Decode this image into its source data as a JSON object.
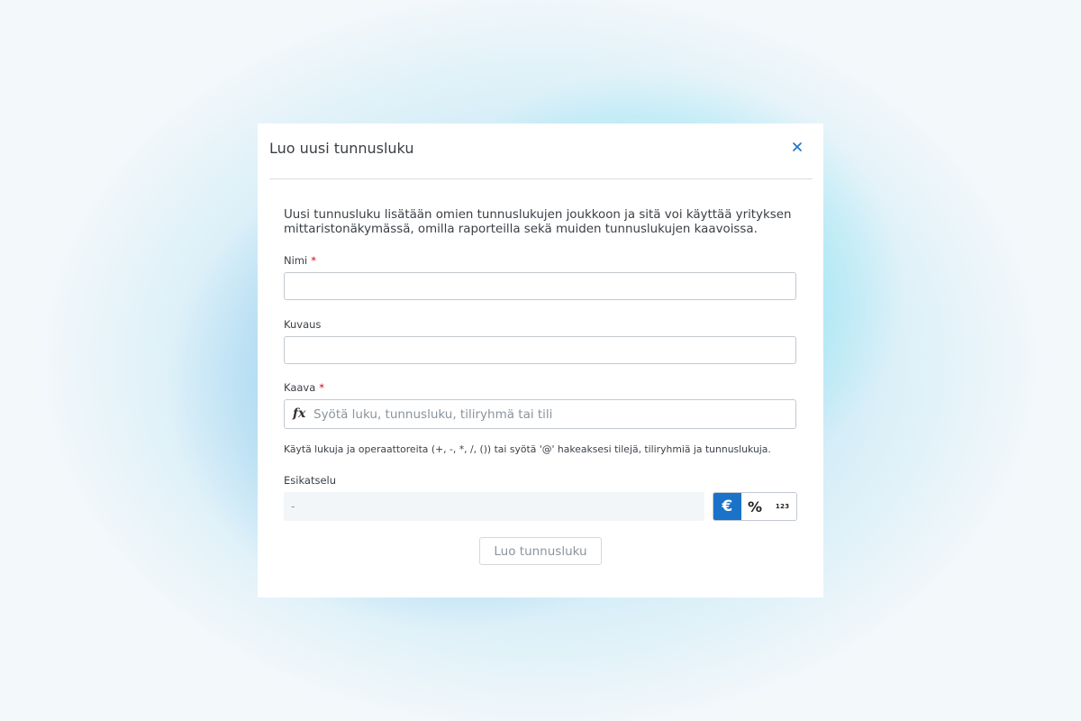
{
  "dialog": {
    "title": "Luo uusi tunnusluku",
    "close_icon": "close-icon",
    "intro_text": "Uusi tunnusluku lisätään omien tunnuslukujen joukkoon ja sitä voi käyttää yrityksen mittaristonäkymässä, omilla raporteilla sekä muiden tunnuslukujen kaavoissa.",
    "name_field": {
      "label": "Nimi",
      "required_mark": "*",
      "value": ""
    },
    "description_field": {
      "label": "Kuvaus",
      "value": ""
    },
    "formula_field": {
      "label": "Kaava",
      "required_mark": "*",
      "icon": "fx",
      "placeholder": "Syötä luku, tunnusluku, tiliryhmä tai tili",
      "hint": "Käytä lukuja ja operaattoreita (+, -, *, /, ()) tai syötä '@' hakeaksesi tilejä, tiliryhmiä ja tunnuslukuja."
    },
    "preview": {
      "label": "Esikatselu",
      "value": "-",
      "units": [
        {
          "symbol": "€",
          "active": true
        },
        {
          "symbol": "%",
          "active": false
        },
        {
          "symbol": "123",
          "active": false
        }
      ]
    },
    "submit_label": "Luo tunnusluku"
  },
  "colors": {
    "accent": "#1a73c8",
    "required": "#d0021b",
    "text": "#3a3f45",
    "muted": "#8c949b"
  }
}
